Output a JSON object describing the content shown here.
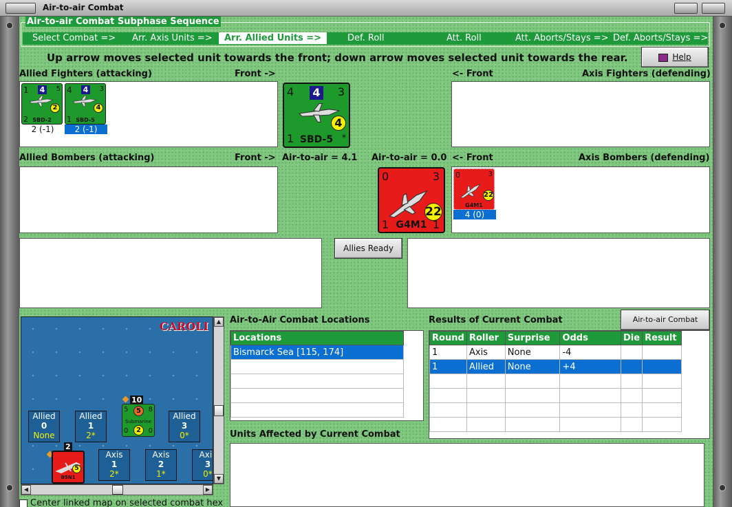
{
  "window": {
    "title": "Air-to-air Combat"
  },
  "subphase": {
    "title": "Air-to-air Combat Subphase Sequence",
    "steps": [
      "Select Combat =>",
      "Arr. Axis Units =>",
      "Arr. Allied Units =>",
      "Def. Roll",
      "Att. Roll",
      "Att. Aborts/Stays =>",
      "Def. Aborts/Stays =>"
    ],
    "active_index": 2
  },
  "instruction": "Up arrow moves selected unit towards the front; down arrow moves selected unit towards the rear.",
  "help_label": "Help",
  "sections": {
    "allied_fighters": "Allied Fighters (attacking)",
    "front_right": "Front ->",
    "front_left": "<- Front",
    "axis_fighters": "Axis Fighters (defending)",
    "allied_bombers": "Allied Bombers (attacking)",
    "axis_bombers": "Axis Bombers (defending)",
    "allied_air_to_air": "Air-to-air = 4.1",
    "axis_air_to_air": "Air-to-air = 0.0"
  },
  "allied_fighters": [
    {
      "tl": "1",
      "box": "4",
      "tr": "5",
      "bl": "2",
      "circle": "2",
      "name": "SBD-2",
      "value": "2 (-1)",
      "selected": false
    },
    {
      "tl": "4",
      "box": "4",
      "tr": "3",
      "bl": "1",
      "circle": "4",
      "name": "SBD-5",
      "value": "2 (-1)",
      "selected": true
    }
  ],
  "allied_big": {
    "tl": "4",
    "box": "4",
    "tr": "3",
    "bl": "1",
    "circle": "4",
    "name": "SBD-5",
    "star": "*"
  },
  "axis_big": {
    "tl": "0",
    "tr": "3",
    "bl": "1",
    "br": "1",
    "circle": "22",
    "name": "G4M1"
  },
  "axis_bombers": [
    {
      "tl": "0",
      "tr": "3",
      "circle": "22",
      "name": "G4M1",
      "value": "4 (0)",
      "selected": true
    }
  ],
  "allies_ready_label": "Allies Ready",
  "locations": {
    "title": "Air-to-Air Combat Locations",
    "header": "Locations",
    "rows": [
      "Bismarck Sea [115, 174]"
    ]
  },
  "results": {
    "title": "Results of Current Combat",
    "chart_button": "Air-to-air Combat Chart",
    "headers": [
      "Round",
      "Roller",
      "Surprise",
      "Odds",
      "Die",
      "Result"
    ],
    "rows": [
      [
        "1",
        "Axis",
        "None",
        "-4",
        "",
        ""
      ],
      [
        "1",
        "Allied",
        "None",
        "+4",
        "",
        ""
      ]
    ]
  },
  "units_affected_title": "Units Affected by Current Combat",
  "map": {
    "label": "CAROLI",
    "allied_boxes": [
      {
        "side": "Allied",
        "num": "0",
        "sub": "None"
      },
      {
        "side": "Allied",
        "num": "1",
        "sub": "2*"
      },
      {
        "side": "Allied",
        "num": "3",
        "sub": "0*"
      }
    ],
    "axis_boxes": [
      {
        "side": "Axis",
        "num": "1",
        "sub": "2*"
      },
      {
        "side": "Axis",
        "num": "2",
        "sub": "1*"
      },
      {
        "side": "Axis",
        "num": "3",
        "sub": "0*"
      }
    ],
    "submarine": {
      "name": "Submarine",
      "top": "5",
      "stack": "10",
      "tl": "5",
      "tr": "8",
      "circle": "2",
      "bl": "0",
      "br": "0"
    },
    "axis_unit": {
      "name": "B5N1",
      "stack": "2",
      "circle": "5"
    }
  },
  "center_checkbox_label": "Center linked map on selected combat hex"
}
